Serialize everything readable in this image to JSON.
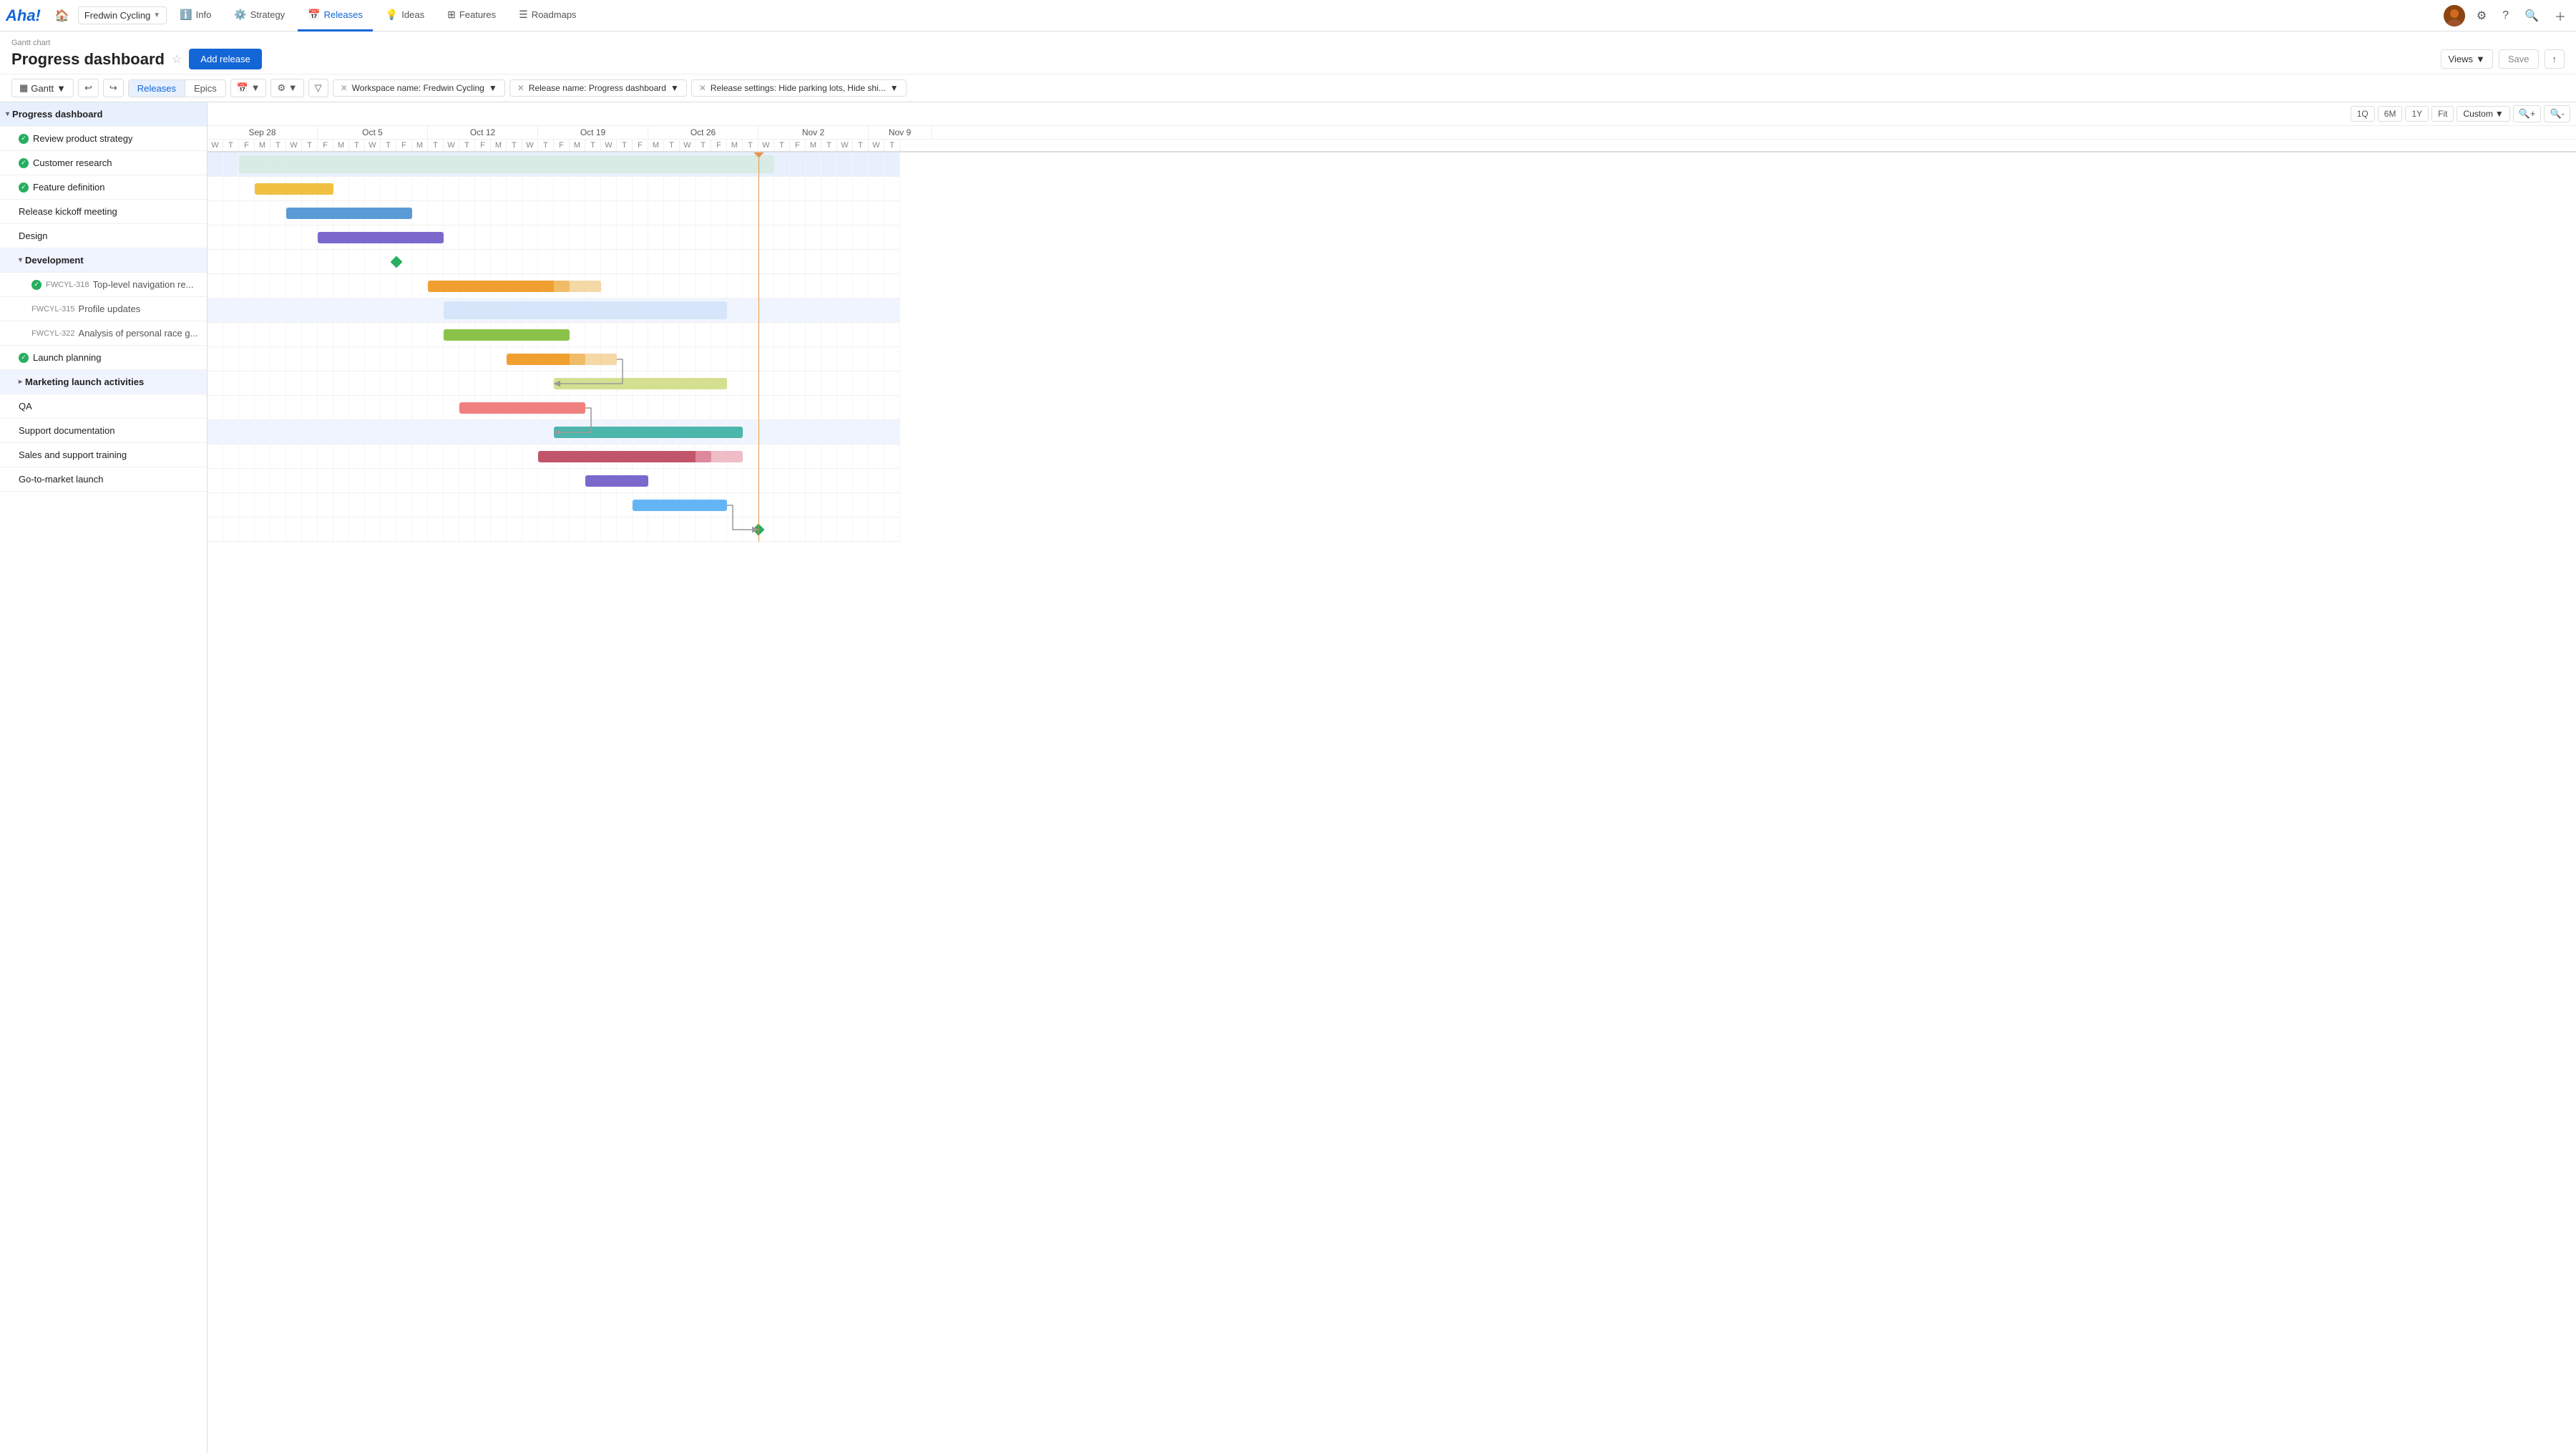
{
  "app": {
    "logo": "Aha!",
    "workspace": "Fredwin Cycling",
    "nav_tabs": [
      {
        "id": "home",
        "icon": "🏠",
        "label": "",
        "active": false
      },
      {
        "id": "info",
        "icon": "ℹ️",
        "label": "Info",
        "active": false
      },
      {
        "id": "strategy",
        "icon": "⚙️",
        "label": "Strategy",
        "active": false
      },
      {
        "id": "releases",
        "icon": "📅",
        "label": "Releases",
        "active": true
      },
      {
        "id": "ideas",
        "icon": "💡",
        "label": "Ideas",
        "active": false
      },
      {
        "id": "features",
        "icon": "⊞",
        "label": "Features",
        "active": false
      },
      {
        "id": "roadmaps",
        "icon": "☰",
        "label": "Roadmaps",
        "active": false
      }
    ]
  },
  "header": {
    "subtitle": "Gantt chart",
    "title": "Progress dashboard",
    "add_release_label": "Add release",
    "views_label": "Views",
    "save_label": "Save"
  },
  "toolbar": {
    "gantt_label": "Gantt",
    "releases_label": "Releases",
    "epics_label": "Epics",
    "filters": [
      {
        "label": "Workspace name: Fredwin Cycling"
      },
      {
        "label": "Release name: Progress dashboard"
      },
      {
        "label": "Release settings: Hide parking lots, Hide shi..."
      }
    ]
  },
  "zoom": {
    "buttons": [
      "1Q",
      "6M",
      "1Y",
      "Fit",
      "Custom"
    ],
    "active": "Custom",
    "active_index": 4
  },
  "gantt": {
    "day_width": 22,
    "start_offset_days": 0,
    "months": [
      {
        "label": "Sep 28",
        "days": 7
      },
      {
        "label": "Oct 5",
        "days": 7
      },
      {
        "label": "Oct 12",
        "days": 7
      },
      {
        "label": "Oct 19",
        "days": 7
      },
      {
        "label": "Oct 26",
        "days": 7
      },
      {
        "label": "Nov 2",
        "days": 7
      },
      {
        "label": "Nov 9",
        "days": 4
      }
    ],
    "day_labels": [
      "W",
      "T",
      "F",
      "M",
      "T",
      "W",
      "T",
      "F",
      "M",
      "T",
      "W",
      "T",
      "F",
      "M",
      "T",
      "W",
      "T",
      "F",
      "M",
      "T",
      "W",
      "T",
      "F",
      "M",
      "T",
      "W",
      "T",
      "F",
      "M",
      "T",
      "W",
      "T",
      "F",
      "M",
      "T",
      "W",
      "T",
      "F",
      "M",
      "T",
      "W",
      "T",
      "W",
      "T"
    ],
    "today_day_index": 35,
    "rows": [
      {
        "id": "progress-dashboard",
        "indent": 0,
        "type": "group-main",
        "expanded": true,
        "label": "Progress dashboard",
        "bar": {
          "start": 2,
          "end": 36,
          "color": "#c8e6c9",
          "opacity": 0.5
        }
      },
      {
        "id": "review-product",
        "indent": 1,
        "type": "item",
        "status": "done",
        "label": "Review product strategy",
        "bar": {
          "start": 3,
          "end": 8,
          "color": "#f0c040"
        }
      },
      {
        "id": "customer-research",
        "indent": 1,
        "type": "item",
        "status": "done",
        "label": "Customer research",
        "bar": {
          "start": 5,
          "end": 13,
          "color": "#5b9bd5"
        }
      },
      {
        "id": "feature-definition",
        "indent": 1,
        "type": "item",
        "status": "done",
        "label": "Feature definition",
        "bar": {
          "start": 7,
          "end": 15,
          "color": "#7b68cc"
        }
      },
      {
        "id": "release-kickoff",
        "indent": 1,
        "type": "milestone",
        "label": "Release kickoff meeting",
        "milestone_day": 12
      },
      {
        "id": "design",
        "indent": 1,
        "type": "item",
        "label": "Design",
        "bar": {
          "start": 14,
          "end": 23,
          "color": "#f0a030",
          "trail": {
            "start": 22,
            "end": 25,
            "color": "#f0c880"
          }
        }
      },
      {
        "id": "development",
        "indent": 1,
        "type": "group",
        "expanded": true,
        "label": "Development",
        "bar": {
          "start": 15,
          "end": 33,
          "color": "#b0d0f0",
          "opacity": 0.4
        }
      },
      {
        "id": "fwcyl-318",
        "indent": 2,
        "type": "item",
        "status": "done",
        "ticket": "FWCYL-318",
        "label": "Top-level navigation re...",
        "bar": {
          "start": 15,
          "end": 23,
          "color": "#8bc34a"
        }
      },
      {
        "id": "fwcyl-315",
        "indent": 2,
        "type": "item",
        "ticket": "FWCYL-315",
        "label": "Profile updates",
        "bar": {
          "start": 19,
          "end": 24,
          "color": "#f0a030",
          "trail": {
            "start": 23,
            "end": 26,
            "color": "#f0c880"
          }
        }
      },
      {
        "id": "fwcyl-322",
        "indent": 2,
        "type": "item",
        "ticket": "FWCYL-322",
        "label": "Analysis of personal race g...",
        "bar": {
          "start": 22,
          "end": 33,
          "color": "#d4e090"
        }
      },
      {
        "id": "launch-planning",
        "indent": 1,
        "type": "item",
        "status": "done",
        "label": "Launch planning",
        "bar": {
          "start": 16,
          "end": 24,
          "color": "#f08080"
        }
      },
      {
        "id": "marketing-launch",
        "indent": 1,
        "type": "group",
        "expanded": false,
        "label": "Marketing launch activities",
        "bar": {
          "start": 22,
          "end": 34,
          "color": "#4db6ac"
        }
      },
      {
        "id": "qa",
        "indent": 1,
        "type": "item",
        "label": "QA",
        "bar": {
          "start": 21,
          "end": 32,
          "color": "#c2556a",
          "trail": {
            "start": 31,
            "end": 34,
            "color": "#e8a0b0"
          }
        }
      },
      {
        "id": "support-docs",
        "indent": 1,
        "type": "item",
        "label": "Support documentation",
        "bar": {
          "start": 24,
          "end": 28,
          "color": "#7b68cc"
        }
      },
      {
        "id": "sales-training",
        "indent": 1,
        "type": "item",
        "label": "Sales and support training",
        "bar": {
          "start": 27,
          "end": 33,
          "color": "#64b5f6"
        }
      },
      {
        "id": "go-to-market",
        "indent": 1,
        "type": "milestone",
        "label": "Go-to-market launch",
        "milestone_day": 35
      }
    ]
  }
}
